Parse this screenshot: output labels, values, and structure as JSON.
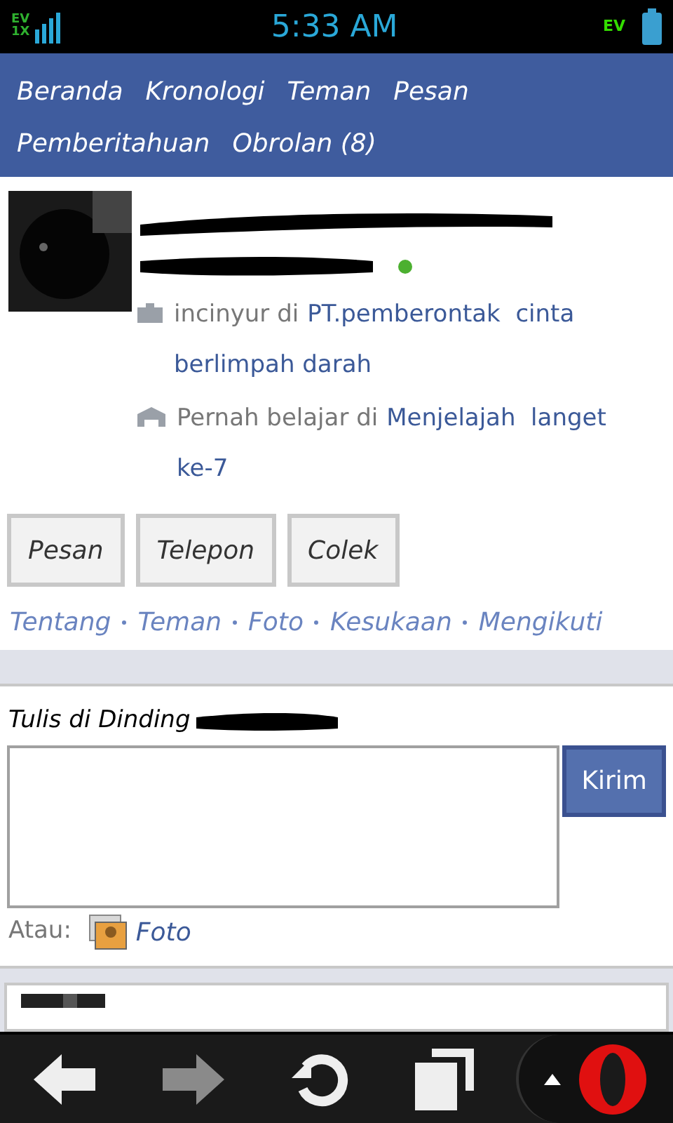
{
  "status_bar": {
    "network_top": "EV",
    "network_bottom": "1X",
    "data_label": "EV",
    "time": "5:33 AM"
  },
  "nav": {
    "items": [
      {
        "label": "Beranda"
      },
      {
        "label": "Kronologi"
      },
      {
        "label": "Teman"
      },
      {
        "label": "Pesan"
      },
      {
        "label": "Pemberitahuan"
      },
      {
        "label": "Obrolan (8)"
      }
    ]
  },
  "profile": {
    "online": true,
    "details": [
      {
        "kind": "work",
        "prefix": "incinyur di",
        "link_lines": [
          "PT.pemberontak  cinta",
          "berlimpah darah"
        ]
      },
      {
        "kind": "school",
        "prefix": "Pernah belajar  di",
        "link_lines": [
          "Menjelajah  langet",
          "ke-7"
        ]
      }
    ],
    "buttons": [
      "Pesan",
      "Telepon",
      "Colek"
    ],
    "links": [
      "Tentang",
      "Teman",
      "Foto",
      "Kesukaan",
      "Mengikuti"
    ]
  },
  "wall": {
    "label": "Tulis di Dinding",
    "submit": "Kirim",
    "alt_label": "Atau:",
    "photo_link": "Foto"
  },
  "toolbar": [
    {
      "kind": "back",
      "disabled": false
    },
    {
      "kind": "forward",
      "disabled": true
    },
    {
      "kind": "reload",
      "disabled": false
    },
    {
      "kind": "tabs",
      "disabled": false
    }
  ]
}
